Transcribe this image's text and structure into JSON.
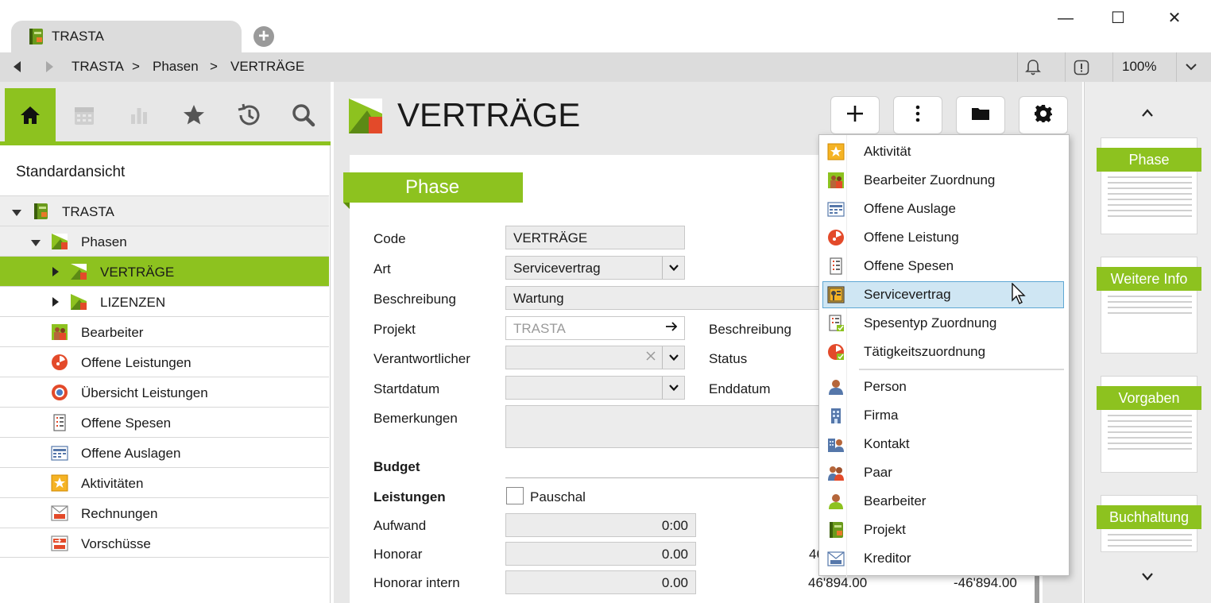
{
  "window": {
    "tab_title": "TRASTA",
    "new_tab": "+",
    "minimize": "—",
    "maximize": "☐",
    "close": "✕"
  },
  "breadcrumb": {
    "items": [
      "TRASTA",
      "Phasen",
      "VERTRÄGE"
    ],
    "separator": ">"
  },
  "navbar": {
    "zoom": "100%"
  },
  "sidebar": {
    "view_title": "Standardansicht",
    "tabs": [
      "home-icon",
      "calendar-icon",
      "chart-icon",
      "star-icon",
      "history-icon",
      "search-icon"
    ],
    "tree": [
      {
        "label": "TRASTA"
      },
      {
        "label": "Phasen"
      },
      {
        "label": "VERTRÄGE"
      },
      {
        "label": "LIZENZEN"
      },
      {
        "label": "Bearbeiter"
      },
      {
        "label": "Offene Leistungen"
      },
      {
        "label": "Übersicht Leistungen"
      },
      {
        "label": "Offene Spesen"
      },
      {
        "label": "Offene Auslagen"
      },
      {
        "label": "Aktivitäten"
      },
      {
        "label": "Rechnungen"
      },
      {
        "label": "Vorschüsse"
      }
    ]
  },
  "main": {
    "title": "VERTRÄGE",
    "toolbar": {
      "add": "+",
      "more": "⋮"
    },
    "form": {
      "banner": "Phase",
      "code_label": "Code",
      "code_value": "VERTRÄGE",
      "art_label": "Art",
      "art_value": "Servicevertrag",
      "beschreibung_label": "Beschreibung",
      "beschreibung_value": "Wartung",
      "projekt_label": "Projekt",
      "projekt_value": "TRASTA",
      "beschreibung2_label": "Beschreibung",
      "verantwortlicher_label": "Verantwortlicher",
      "status_label": "Status",
      "startdatum_label": "Startdatum",
      "enddatum_label": "Enddatum",
      "bemerkungen_label": "Bemerkungen",
      "budget_label": "Budget",
      "leistungen_label": "Leistungen",
      "pauschal_label": "Pauschal",
      "aufwand_label": "Aufwand",
      "aufwand_value": "0:00",
      "honorar_label": "Honorar",
      "honorar_value": "0.00",
      "honorar_partial": "46",
      "honorar_intern_label": "Honorar intern",
      "honorar_intern_value": "0.00",
      "honorar_intern_col2": "46'894.00",
      "honorar_intern_col3": "-46'894.00"
    }
  },
  "menu": {
    "items": [
      {
        "label": "Aktivität"
      },
      {
        "label": "Bearbeiter Zuordnung"
      },
      {
        "label": "Offene Auslage"
      },
      {
        "label": "Offene Leistung"
      },
      {
        "label": "Offene Spesen"
      },
      {
        "label": "Servicevertrag"
      },
      {
        "label": "Spesentyp Zuordnung"
      },
      {
        "label": "Tätigkeitszuordnung"
      },
      {
        "label": "Person"
      },
      {
        "label": "Firma"
      },
      {
        "label": "Kontakt"
      },
      {
        "label": "Paar"
      },
      {
        "label": "Bearbeiter"
      },
      {
        "label": "Projekt"
      },
      {
        "label": "Kreditor"
      }
    ],
    "highlighted": "Servicevertrag"
  },
  "thumbnails": {
    "items": [
      "Phase",
      "Weitere Info",
      "Vorgaben",
      "Buchhaltung"
    ],
    "up": "⌃",
    "down": "⌄"
  },
  "colors": {
    "accent": "#8dc21f",
    "highlight": "#cfe6f3"
  }
}
